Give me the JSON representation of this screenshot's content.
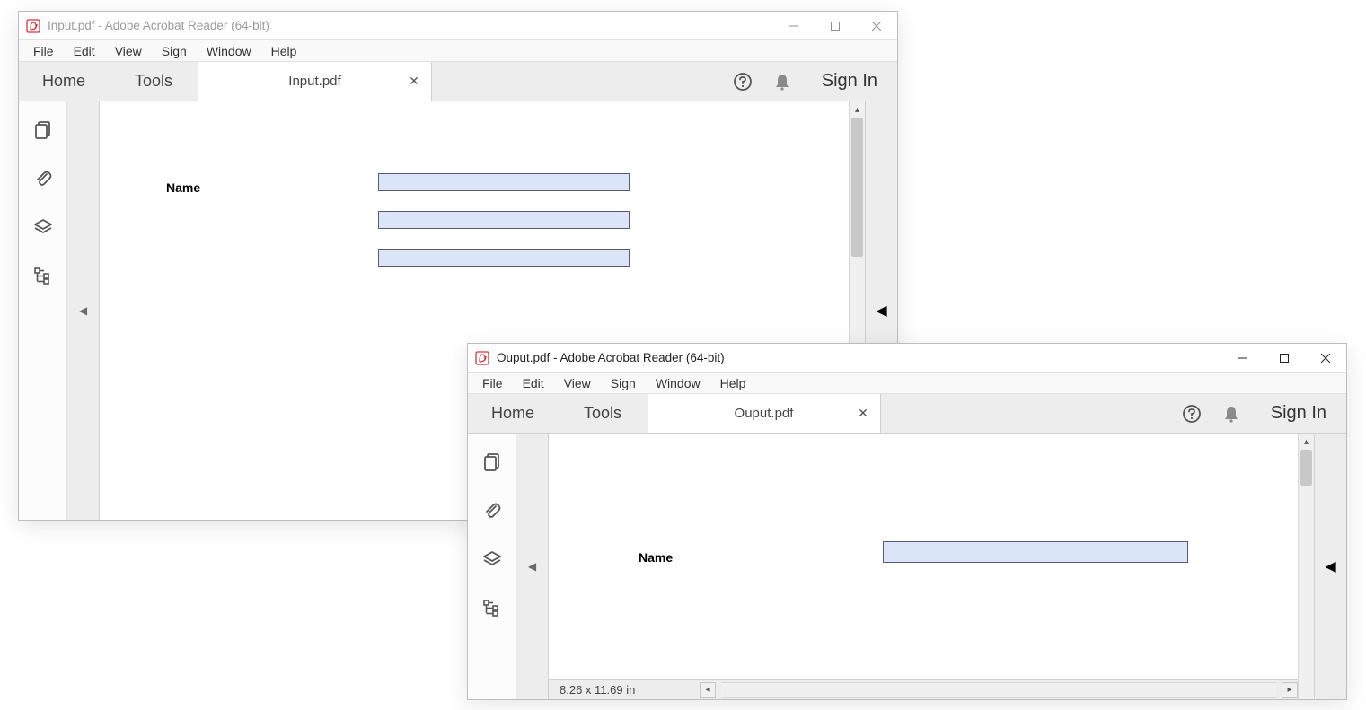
{
  "windows": [
    {
      "id": "win1",
      "active": false,
      "title": "Input.pdf - Adobe Acrobat Reader (64-bit)",
      "menu": [
        "File",
        "Edit",
        "View",
        "Sign",
        "Window",
        "Help"
      ],
      "home_label": "Home",
      "tools_label": "Tools",
      "doc_tab_label": "Input.pdf",
      "signin_label": "Sign In",
      "form": {
        "label": "Name",
        "field_count": 3
      }
    },
    {
      "id": "win2",
      "active": true,
      "title": "Ouput.pdf - Adobe Acrobat Reader (64-bit)",
      "menu": [
        "File",
        "Edit",
        "View",
        "Sign",
        "Window",
        "Help"
      ],
      "home_label": "Home",
      "tools_label": "Tools",
      "doc_tab_label": "Ouput.pdf",
      "signin_label": "Sign In",
      "form": {
        "label": "Name",
        "field_count": 1
      },
      "status_text": "8.26 x 11.69 in"
    }
  ]
}
